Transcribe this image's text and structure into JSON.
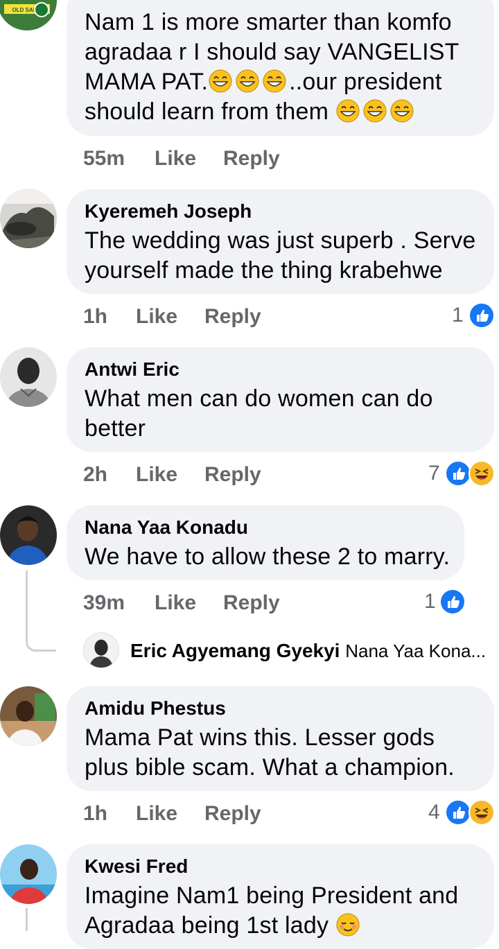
{
  "comments": [
    {
      "name": "",
      "text_lines": [
        "Nam 1 is more smarter than komfo",
        "agradaa r I should say VANGELIST",
        "MAMA PAT.",
        "..our president",
        "should learn from them"
      ],
      "time": "55m",
      "reaction_count": ""
    },
    {
      "name": "Kyeremeh Joseph",
      "text_lines": [
        "The wedding was just superb . Serve",
        "yourself made the thing krabehwe"
      ],
      "time": "1h",
      "reaction_count": "1"
    },
    {
      "name": "Antwi Eric",
      "text_lines": [
        "What men can do women can do",
        "better"
      ],
      "time": "2h",
      "reaction_count": "7"
    },
    {
      "name": "Nana Yaa Konadu",
      "text_lines": [
        "We have to allow these 2 to marry."
      ],
      "time": "39m",
      "reaction_count": "1"
    },
    {
      "name": "Amidu Phestus",
      "text_lines": [
        "Mama Pat wins this. Lesser gods",
        "plus bible scam. What a champion."
      ],
      "time": "1h",
      "reaction_count": "4"
    },
    {
      "name": "Kwesi Fred",
      "text_lines": [
        "Imagine Nam1 being President and",
        "Agradaa being 1st lady"
      ],
      "time": "",
      "reaction_count": ""
    }
  ],
  "reply_preview": {
    "name": "Eric Agyemang Gyekyi",
    "snippet": "Nana Yaa Kona..."
  },
  "actions": {
    "like": "Like",
    "reply": "Reply"
  },
  "colors": {
    "bubble": "#f0f2f5",
    "meta": "#65676b",
    "like_blue": "#1877f2",
    "haha_yellow": "#f7b928"
  },
  "icons": [
    "like-reaction-icon",
    "haha-reaction-icon",
    "grinning-emoji-icon",
    "relieved-emoji-icon"
  ]
}
